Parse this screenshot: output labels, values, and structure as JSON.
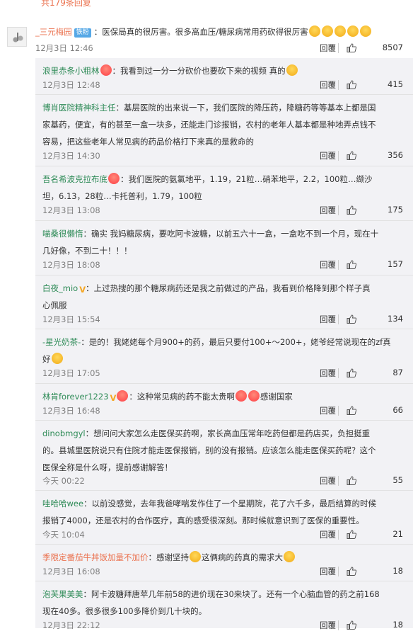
{
  "top": {
    "more_replies": "共179条回复"
  },
  "main": {
    "username": "_三元梅园",
    "badge": "铁粉",
    "text": "：医保局真的很厉害。很多高血压/糖尿病常用药砍得很厉害",
    "date": "12月3日 12:46",
    "reply_label": "回覆",
    "likes": "8507"
  },
  "replies": [
    {
      "user": "浪里赤条小粗林",
      "text": "：我看到过一分一分砍价也要砍下来的视频 真的",
      "date": "12月3日 12:48",
      "reply_label": "回覆",
      "likes": "415"
    },
    {
      "user": "博肖医院精神科主任",
      "text1": "：基层医院的出来说一下，我们医院的降压药，降糖药等等基本上都是国",
      "text2": "家基药，便宜，有的甚至一盒一块多，还能走门诊报销，农村的老年人基本都是种地弄点钱不",
      "text3": "容易，把这些老年人常见病的药品价格打下来真的是救命的",
      "date": "12月3日 14:30",
      "reply_label": "回覆",
      "likes": "356"
    },
    {
      "user": "吾名希波克拉布底",
      "text1": "：我们医院的氨氯地平，1.19，21粒…硝苯地平，2.2，100粒…缬沙",
      "text2": "坦，6.13，28粒…卡托普利，1.79，100粒",
      "date": "12月3日 13:08",
      "reply_label": "回覆",
      "likes": "175"
    },
    {
      "user": "喵桑很懒惰",
      "text1": "：确实 我妈糖尿病，要吃阿卡波糖，以前五六十一盒，一盒吃不到一个月，现在十",
      "text2": "几好像，不到二十！！！",
      "date": "12月3日 18:08",
      "reply_label": "回覆",
      "likes": "157"
    },
    {
      "user": "白夜_mio",
      "text1": "：上过热搜的那个糖尿病药还是我之前做过的产品，我看到价格降到那个样子真",
      "text2": "心佩服",
      "date": "12月3日 15:54",
      "reply_label": "回覆",
      "likes": "134"
    },
    {
      "user": "-星光奶茶-",
      "text1": "：是的！我姥姥每个月900+的药，最后只要付100+～200+，姥爷经常说现在的zf真",
      "text2": "好",
      "date": "12月3日 17:05",
      "reply_label": "回覆",
      "likes": "87"
    },
    {
      "user": "林肯forever1223",
      "text": "：这种常见病的药不能太贵啊",
      "text_end": "感谢国家",
      "date": "12月3日 16:48",
      "reply_label": "回覆",
      "likes": "66"
    },
    {
      "user": "dinobmgyl",
      "text1": "：想问问大家怎么走医保买药啊，家长高血压常年吃药但都是药店买，负担挺重",
      "text2": "的。县城里医院说只有住院才能走医保报销，别的没有报销。应该怎么能走医保买药呢？这个",
      "text3": "医保全称是什么呀，提前感谢解答！",
      "date": "今天 00:22",
      "reply_label": "回覆",
      "likes": "55"
    },
    {
      "user": "哇哈哈wee",
      "text1": "：以前没感觉，去年我爸哮喘发作住了一个星期院，花了六千多，最后结算的时候",
      "text2": "报销了4000，还是农村的合作医疗，真的感受很深刻。那时候就意识到了医保的重要性。",
      "date": "今天 10:04",
      "reply_label": "回覆",
      "likes": "21"
    },
    {
      "user": "季限定番茄牛丼饭加量不加价",
      "text": "：感谢坚持",
      "text_mid": "这俩病的药真的需求大",
      "date": "12月3日 16:08",
      "reply_label": "回覆",
      "likes": "18"
    },
    {
      "user": "泡芙果美美",
      "text1": "：阿卡波糖拜唐苹几年前58的进价现在30来块了。还有一个心脑血管的药之前168",
      "text2": "现在40多。很多很多100多降价到几十块的。",
      "date": "12月3日 22:12",
      "reply_label": "回覆",
      "likes": "18"
    }
  ]
}
